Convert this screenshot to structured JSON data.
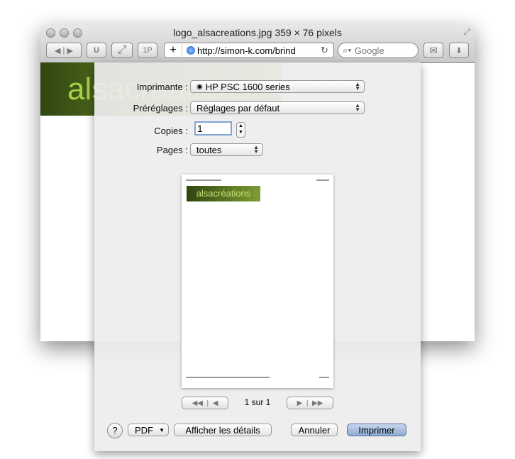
{
  "window": {
    "title": "logo_alsacreations.jpg 359 × 76 pixels"
  },
  "toolbar": {
    "back": "◀",
    "forward": "▶",
    "reader": "U",
    "resize": "⤢",
    "onepassword": "1P",
    "add": "+",
    "url": "http://simon-k.com/brind",
    "reload": "↻",
    "search_placeholder": "Google",
    "mail": "✉",
    "download": "⬇"
  },
  "page_logo": "alsacréations",
  "print": {
    "printer_label": "Imprimante :",
    "printer_value": "HP PSC 1600 series",
    "presets_label": "Préréglages :",
    "presets_value": "Réglages par défaut",
    "copies_label": "Copies :",
    "copies_value": "1",
    "pages_label": "Pages :",
    "pages_value": "toutes",
    "preview_logo": "alsacréations",
    "page_indicator": "1 sur 1",
    "help": "?",
    "pdf": "PDF",
    "details": "Afficher les détails",
    "cancel": "Annuler",
    "print": "Imprimer"
  }
}
